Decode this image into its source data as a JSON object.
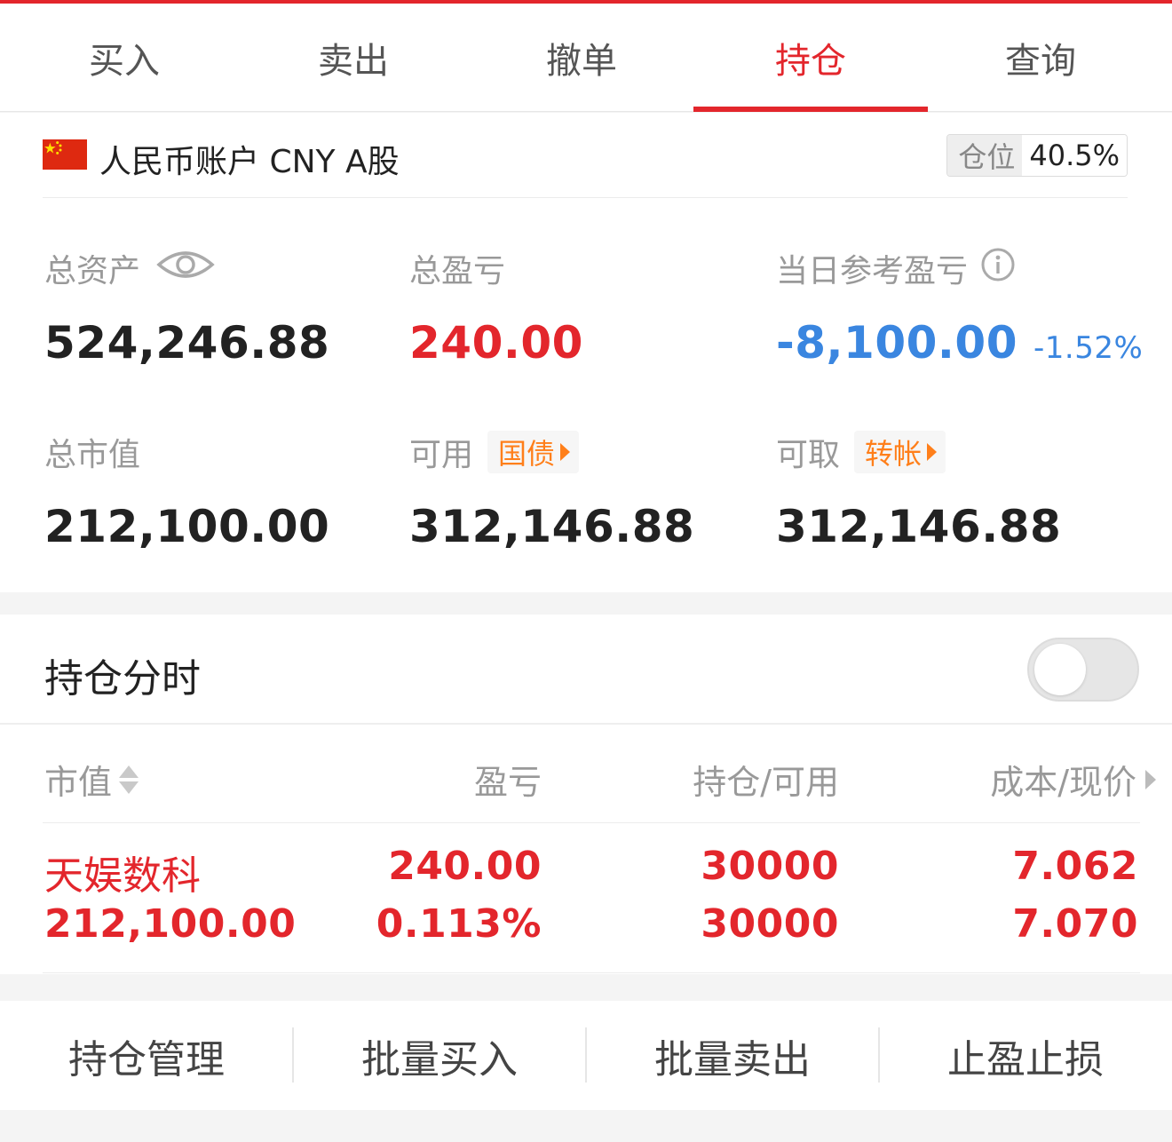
{
  "tabs": [
    {
      "label": "买入"
    },
    {
      "label": "卖出"
    },
    {
      "label": "撤单"
    },
    {
      "label": "持仓",
      "active": true
    },
    {
      "label": "查询"
    }
  ],
  "account": {
    "name": "人民币账户 CNY A股",
    "position_label": "仓位",
    "position_value": "40.5%"
  },
  "stats": {
    "total_assets": {
      "label": "总资产",
      "value": "524,246.88"
    },
    "total_pnl": {
      "label": "总盈亏",
      "value": "240.00"
    },
    "daily_pnl": {
      "label": "当日参考盈亏",
      "value": "-8,100.00",
      "pct": "-1.52%"
    },
    "market_value": {
      "label": "总市值",
      "value": "212,100.00"
    },
    "available": {
      "label": "可用",
      "tag": "国债",
      "value": "312,146.88"
    },
    "withdrawable": {
      "label": "可取",
      "tag": "转帐",
      "value": "312,146.88"
    }
  },
  "holdings": {
    "title": "持仓分时",
    "toggle_on": false,
    "columns": [
      "市值",
      "盈亏",
      "持仓/可用",
      "成本/现价"
    ],
    "rows": [
      {
        "name": "天娱数科",
        "market_value": "212,100.00",
        "pnl": "240.00",
        "pnl_pct": "0.113%",
        "position": "30000",
        "available": "30000",
        "cost": "7.062",
        "price": "7.070"
      }
    ]
  },
  "actions": [
    "持仓管理",
    "批量买入",
    "批量卖出",
    "止盈止损"
  ],
  "colors": {
    "accent_red": "#e3262c",
    "loss_blue": "#3a86e0",
    "tag_orange": "#ff7f1a"
  },
  "icons": [
    "cn-flag-icon",
    "eye-icon",
    "info-icon",
    "sort-icon",
    "chevron-right-icon"
  ]
}
